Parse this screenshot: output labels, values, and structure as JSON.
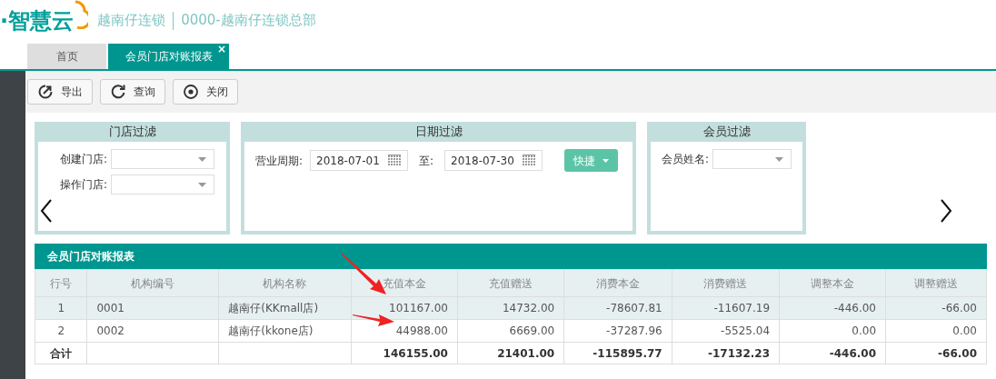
{
  "header": {
    "logo_text": "·智慧云",
    "company": "越南仔连锁",
    "branch": "0000-越南仔连锁总部"
  },
  "tabs": [
    {
      "label": "首页",
      "selected": false
    },
    {
      "label": "会员门店对账报表",
      "selected": true,
      "close_label": "×"
    }
  ],
  "toolbar": [
    {
      "kind": "export",
      "label": "导出"
    },
    {
      "kind": "refresh",
      "label": "查询"
    },
    {
      "kind": "close",
      "label": "关闭"
    }
  ],
  "filters": [
    {
      "title": "门店过滤",
      "kind": "stores",
      "fields": [
        {
          "label": "创建门店:"
        },
        {
          "label": "操作门店:"
        }
      ]
    },
    {
      "title": "日期过滤",
      "kind": "dates",
      "label": "营业周期:",
      "from": "2018-07-01",
      "to_label": "至:",
      "to": "2018-07-30",
      "quick": "快捷"
    },
    {
      "title": "会员过滤",
      "kind": "member",
      "fields": [
        {
          "label": "会员姓名:"
        }
      ]
    }
  ],
  "report": {
    "title": "会员门店对账报表",
    "columns": [
      "行号",
      "机构编号",
      "机构名称",
      "充值本金",
      "充值赠送",
      "消费本金",
      "消费赠送",
      "调整本金",
      "调整赠送"
    ],
    "rows": [
      [
        "1",
        "0001",
        "越南仔(KKmall店)",
        "101167.00",
        "14732.00",
        "-78607.81",
        "-11607.19",
        "-446.00",
        "-66.00"
      ],
      [
        "2",
        "0002",
        "越南仔(kkone店)",
        "44988.00",
        "6669.00",
        "-37287.96",
        "-5525.04",
        "0.00",
        "0.00"
      ]
    ],
    "total": {
      "label": "合计",
      "values": [
        "146155.00",
        "21401.00",
        "-115895.77",
        "-17132.23",
        "-446.00",
        "-66.00"
      ]
    }
  }
}
